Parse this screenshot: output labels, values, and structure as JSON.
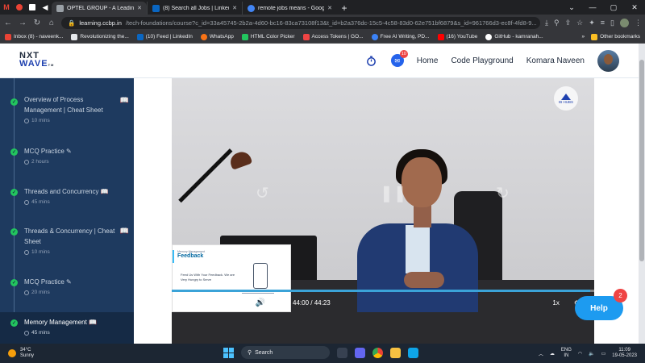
{
  "browser": {
    "tabs": [
      {
        "title": "",
        "icon_color": "#ea4335",
        "kind": "pinned"
      },
      {
        "title": "",
        "icon_color": "#ea4335",
        "kind": "pinned"
      },
      {
        "title": "",
        "icon_color": "#ffffff",
        "kind": "pinned"
      },
      {
        "title": "",
        "icon_color": "#e8eaed",
        "kind": "pinned"
      },
      {
        "title": "OPTEL GROUP - A Leading Provi",
        "icon_color": "#9aa0a6"
      },
      {
        "title": "(8) Search all Jobs | LinkedIn",
        "icon_color": "#0a66c2"
      },
      {
        "title": "remote jobs means - Google Sea",
        "icon_color": "#4285f4"
      }
    ],
    "url_host": "learning.ccbp.in",
    "url_path": "/tech-foundations/course?c_id=33a45745-2b2a-4d60-bc16-83ca73108f13&t_id=b2a376dc-15c5-4c58-83d0-62e751bf6879&s_id=961766d3-ec8f-4fd8-9...",
    "bookmarks": [
      {
        "label": "Inbox (8) - naveenk...",
        "icon_color": "#ea4335"
      },
      {
        "label": "Revolutionizing the...",
        "icon_color": "#e5e7eb"
      },
      {
        "label": "(10) Feed | LinkedIn",
        "icon_color": "#0a66c2"
      },
      {
        "label": "WhatsApp",
        "icon_color": "#f97316"
      },
      {
        "label": "HTML Color Picker",
        "icon_color": "#22c55e"
      },
      {
        "label": "Access Tokens | GO...",
        "icon_color": "#ef4444"
      },
      {
        "label": "Free AI Writing, PD...",
        "icon_color": "#3b82f6"
      },
      {
        "label": "(16) YouTube",
        "icon_color": "#ff0000"
      },
      {
        "label": "GitHub - kamranah...",
        "icon_color": "#ffffff"
      }
    ],
    "bookmarks_more": "»",
    "other_bookmarks": "Other bookmarks"
  },
  "header": {
    "logo_top": "NXT",
    "logo_bottom": "WAVE",
    "logo_suffix": "TM",
    "chat_badge": "10",
    "nav_home": "Home",
    "nav_playground": "Code Playground",
    "user_name": "Komara Naveen"
  },
  "sidebar": {
    "items": [
      {
        "title": "Overview of Process Management | Cheat Sheet",
        "meta": "10 mins",
        "icon": "book-icon"
      },
      {
        "title": "MCQ Practice",
        "meta": "2 hours",
        "icon": "pencil-icon"
      },
      {
        "title": "Threads and Concurrency",
        "meta": "45 mins",
        "icon": "book-icon"
      },
      {
        "title": "Threads & Concurrency | Cheat Sheet",
        "meta": "10 mins",
        "icon": "book-icon"
      },
      {
        "title": "MCQ Practice",
        "meta": "20 mins",
        "icon": "pencil-icon"
      },
      {
        "title": "Memory Management",
        "meta": "45 mins",
        "icon": "book-icon",
        "active": true
      }
    ]
  },
  "video": {
    "watermark": "IB HUBS",
    "pip_subtitle": "Memory Management",
    "pip_title": "Feedback",
    "pip_text": "Feed Us With Your Feedback. We are Very Hungry to Serve",
    "time_current": "44:00",
    "time_separator": "/",
    "time_total": "44:23",
    "progress_fraction": 0.991,
    "speed": "1x",
    "accent_color": "#3ba3d8"
  },
  "help": {
    "label": "Help",
    "badge": "2"
  },
  "taskbar": {
    "temperature": "34°C",
    "weather": "Sunny",
    "search_label": "Search",
    "lang_top": "ENG",
    "lang_bottom": "IN",
    "time": "11:09",
    "date": "19-05-2023"
  }
}
